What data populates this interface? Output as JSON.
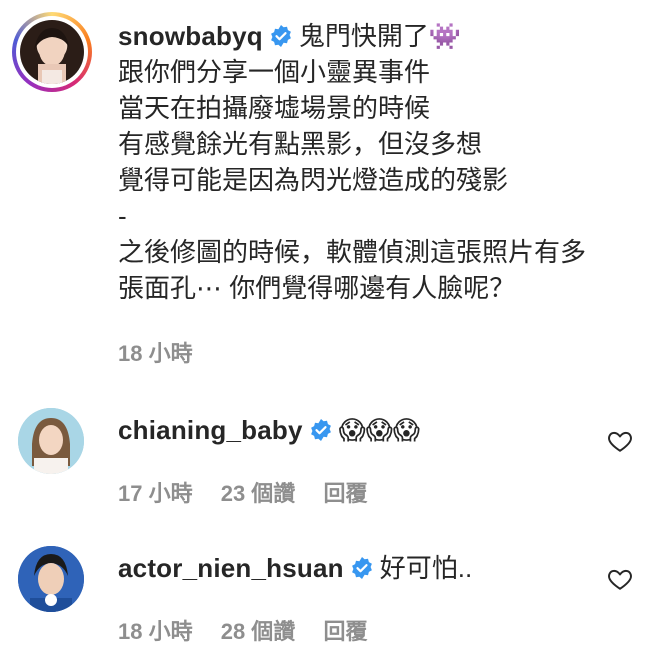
{
  "comments": [
    {
      "username": "snowbabyq",
      "verified": true,
      "lines": [
        "鬼門快開了👾",
        "跟你們分享一個小靈異事件",
        "當天在拍攝廢墟場景的時候",
        "有感覺餘光有點黑影，但沒多想",
        "覺得可能是因為閃光燈造成的殘影",
        "-",
        "之後修圖的時候，軟體偵測這張照片有多",
        "張面孔⋯ 你們覺得哪邊有人臉呢？"
      ],
      "time": "18 小時"
    },
    {
      "username": "chianing_baby",
      "verified": true,
      "text": "😱😱😱",
      "time": "17 小時",
      "likes": "23 個讚",
      "reply": "回覆"
    },
    {
      "username": "actor_nien_hsuan",
      "verified": true,
      "text": "好可怕..",
      "time": "18 小時",
      "likes": "28 個讚",
      "reply": "回覆"
    }
  ],
  "colors": {
    "text": "#262626",
    "meta": "#8e8e8e",
    "verified": "#3897f0"
  }
}
